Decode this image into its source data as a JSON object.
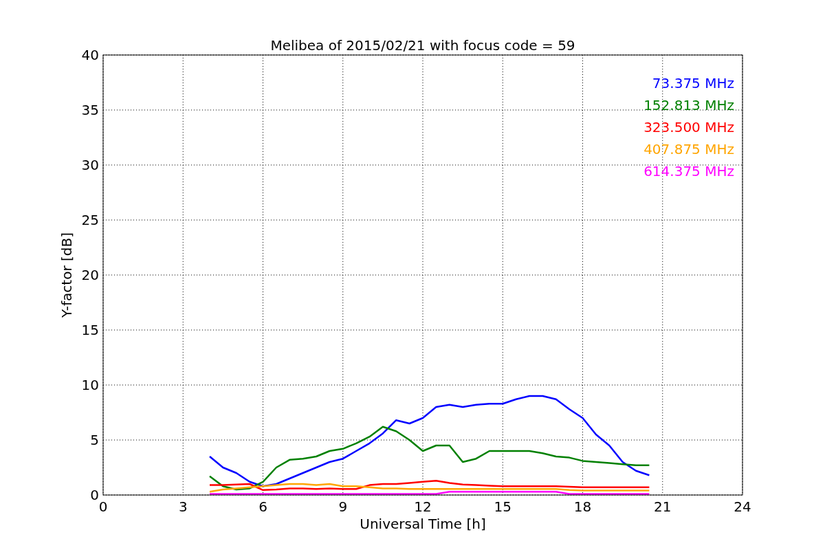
{
  "chart_data": {
    "type": "line",
    "title": "Melibea of 2015/02/21 with focus code = 59",
    "xlabel": "Universal Time [h]",
    "ylabel": "Y-factor [dB]",
    "x": [
      4,
      4.5,
      5,
      5.5,
      6,
      6.5,
      7,
      7.5,
      8,
      8.5,
      9,
      9.5,
      10,
      10.5,
      11,
      11.5,
      12,
      12.5,
      13,
      13.5,
      14,
      14.5,
      15,
      15.5,
      16,
      16.5,
      17,
      17.5,
      18,
      18.5,
      19,
      19.5,
      20,
      20.5
    ],
    "series": [
      {
        "name": "73.375 MHz",
        "color": "#0000ff",
        "values": [
          3.5,
          2.5,
          2,
          1.2,
          0.8,
          1,
          1.5,
          2,
          2.5,
          3,
          3.3,
          4,
          4.7,
          5.6,
          6.8,
          6.5,
          7,
          8,
          8.2,
          8,
          8.2,
          8.3,
          8.3,
          8.7,
          9,
          9,
          8.7,
          7.8,
          7,
          5.5,
          4.5,
          3,
          2.2,
          1.8
        ]
      },
      {
        "name": "152.813 MHz",
        "color": "#008000",
        "values": [
          1.7,
          0.8,
          0.5,
          0.6,
          1.2,
          2.5,
          3.2,
          3.3,
          3.5,
          4,
          4.2,
          4.7,
          5.3,
          6.2,
          5.8,
          5,
          4,
          4.5,
          4.5,
          3,
          3.3,
          4,
          4,
          4,
          4,
          3.8,
          3.5,
          3.4,
          3.1,
          3,
          2.9,
          2.8,
          2.7,
          2.7
        ]
      },
      {
        "name": "323.500 MHz",
        "color": "#ff0000",
        "values": [
          0.9,
          0.9,
          0.95,
          1,
          0.45,
          0.5,
          0.6,
          0.6,
          0.55,
          0.6,
          0.55,
          0.55,
          0.9,
          1,
          1,
          1.1,
          1.2,
          1.3,
          1.1,
          0.95,
          0.9,
          0.85,
          0.8,
          0.8,
          0.8,
          0.8,
          0.8,
          0.75,
          0.7,
          0.7,
          0.7,
          0.7,
          0.7,
          0.7
        ]
      },
      {
        "name": "407.875 MHz",
        "color": "#ffa500",
        "values": [
          0.3,
          0.5,
          0.6,
          0.7,
          0.8,
          0.9,
          1,
          1,
          0.9,
          1,
          0.8,
          0.8,
          0.7,
          0.6,
          0.6,
          0.55,
          0.55,
          0.55,
          0.55,
          0.55,
          0.55,
          0.55,
          0.55,
          0.55,
          0.55,
          0.55,
          0.55,
          0.45,
          0.4,
          0.4,
          0.4,
          0.4,
          0.4,
          0.4
        ]
      },
      {
        "name": "614.375 MHz",
        "color": "#ff00ff",
        "values": [
          0.1,
          0.1,
          0.1,
          0.1,
          0.1,
          0.1,
          0.1,
          0.1,
          0.1,
          0.1,
          0.1,
          0.1,
          0.1,
          0.1,
          0.1,
          0.1,
          0.1,
          0.1,
          0.3,
          0.3,
          0.3,
          0.3,
          0.3,
          0.3,
          0.3,
          0.3,
          0.3,
          0.1,
          0.1,
          0.1,
          0.1,
          0.1,
          0.1,
          0.1
        ]
      }
    ],
    "xlim": [
      0,
      24
    ],
    "grid": true,
    "ylim": [
      0,
      40
    ],
    "xticks": [
      0,
      3,
      6,
      9,
      12,
      15,
      18,
      21,
      24
    ],
    "yticks": [
      0,
      5,
      10,
      15,
      20,
      25,
      30,
      35,
      40
    ]
  }
}
